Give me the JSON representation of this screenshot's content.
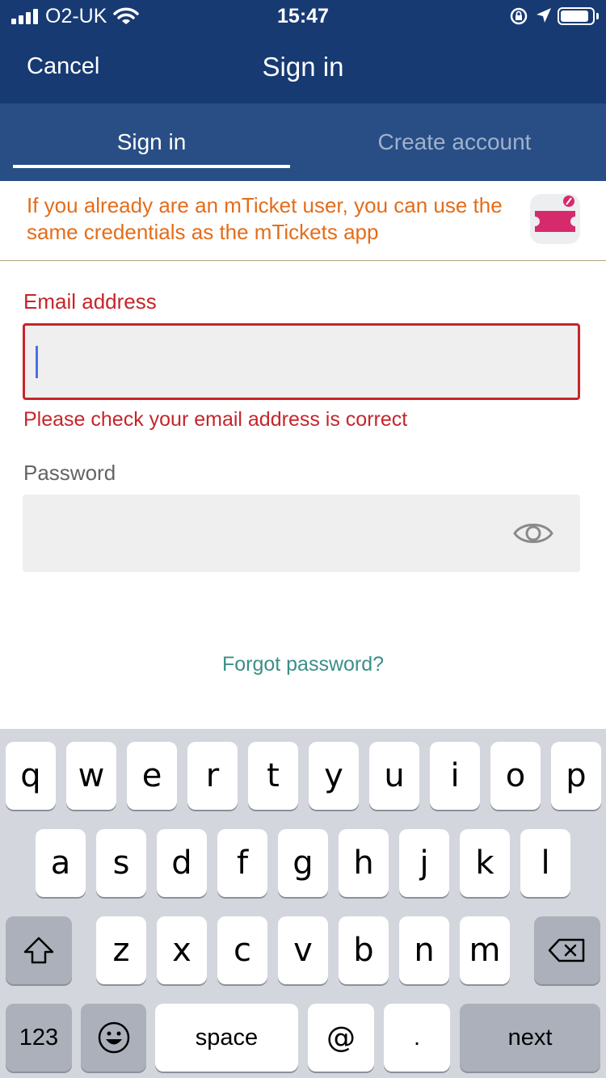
{
  "status_bar": {
    "carrier": "O2-UK",
    "time": "15:47",
    "icons": [
      "signal-bars-icon",
      "wifi-icon",
      "rotation-lock-icon",
      "location-arrow-icon",
      "battery-icon"
    ]
  },
  "header": {
    "cancel_label": "Cancel",
    "title": "Sign in",
    "background": "#173a73"
  },
  "tabs": [
    {
      "label": "Sign in",
      "active": true
    },
    {
      "label": "Create account",
      "active": false
    }
  ],
  "banner": {
    "text": "If you already are an mTicket user, you can use the same credentials as the mTickets app",
    "icon": "mticket-app-icon",
    "color": "#e36d1b"
  },
  "form": {
    "email": {
      "label": "Email address",
      "value": "",
      "error": "Please check your email address is correct",
      "error_color": "#c6252b"
    },
    "password": {
      "label": "Password",
      "value": "",
      "icon": "eye-icon"
    },
    "forgot_label": "Forgot password?"
  },
  "keyboard": {
    "row1": [
      "q",
      "w",
      "e",
      "r",
      "t",
      "y",
      "u",
      "i",
      "o",
      "p"
    ],
    "row2": [
      "a",
      "s",
      "d",
      "f",
      "g",
      "h",
      "j",
      "k",
      "l"
    ],
    "row3": [
      "z",
      "x",
      "c",
      "v",
      "b",
      "n",
      "m"
    ],
    "shift_icon": "shift-arrow-icon",
    "delete_icon": "backspace-icon",
    "numbers_label": "123",
    "emoji_icon": "emoji-icon",
    "space_label": "space",
    "at_label": "@",
    "dot_label": ".",
    "next_label": "next"
  }
}
